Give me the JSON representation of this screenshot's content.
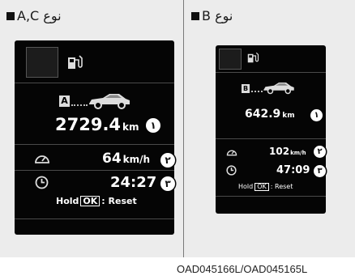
{
  "panel_a": {
    "title": "A,C نوع",
    "car_tag": "A",
    "distance": "2729.4",
    "distance_unit": "km",
    "speed": "64",
    "speed_unit": "km/h",
    "time": "24:27",
    "hold_prefix": "Hold",
    "ok_key": "OK",
    "hold_suffix": ": Reset",
    "badges": [
      "١",
      "٢",
      "٣"
    ]
  },
  "panel_b": {
    "title": "B نوع",
    "car_tag": "B",
    "distance": "642.9",
    "distance_unit": "km",
    "speed": "102",
    "speed_unit": "km/h",
    "time": "47:09",
    "hold_prefix": "Hold",
    "ok_key": "OK",
    "hold_suffix": ": Reset",
    "badges": [
      "١",
      "٢",
      "٣"
    ]
  },
  "figure_code": "OAD045166L/OAD045165L",
  "icons": [
    "fuel-pump-icon",
    "car-icon",
    "speedometer-icon",
    "clock-icon"
  ]
}
